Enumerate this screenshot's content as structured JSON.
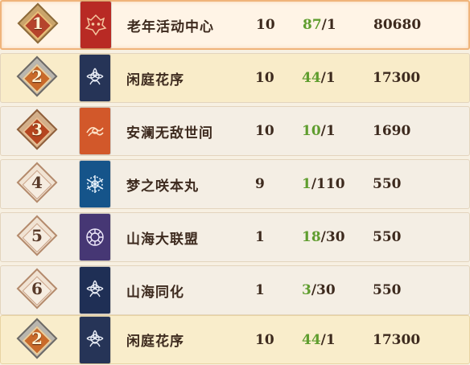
{
  "rows": [
    {
      "rank": "1",
      "name": "老年活动中心",
      "level": "10",
      "members_current": "87",
      "members_max": "/1",
      "score": "80680",
      "badge": "gold",
      "emblem_color": "#b82a24",
      "emblem_icon": "demon-mask-icon"
    },
    {
      "rank": "2",
      "name": "闲庭花序",
      "level": "10",
      "members_current": "44",
      "members_max": "/1",
      "score": "17300",
      "badge": "silver",
      "emblem_color": "#263457",
      "emblem_icon": "flower-crest-icon"
    },
    {
      "rank": "3",
      "name": "安澜无敌世间",
      "level": "10",
      "members_current": "10",
      "members_max": "/1",
      "score": "1690",
      "badge": "bronze",
      "emblem_color": "#d2582a",
      "emblem_icon": "flame-crest-icon"
    },
    {
      "rank": "4",
      "name": "梦之咲本丸",
      "level": "9",
      "members_current": "1",
      "members_max": "/110",
      "score": "550",
      "badge": "plain",
      "emblem_color": "#15548a",
      "emblem_icon": "snowflake-crest-icon"
    },
    {
      "rank": "5",
      "name": "山海大联盟",
      "level": "1",
      "members_current": "18",
      "members_max": "/30",
      "score": "550",
      "badge": "plain",
      "emblem_color": "#463774",
      "emblem_icon": "circle-crest-icon"
    },
    {
      "rank": "6",
      "name": "山海同化",
      "level": "1",
      "members_current": "3",
      "members_max": "/30",
      "score": "550",
      "badge": "plain",
      "emblem_color": "#1f2f55",
      "emblem_icon": "flower-crest-icon"
    }
  ],
  "my_guild": {
    "rank": "2",
    "name": "闲庭花序",
    "level": "10",
    "members_current": "44",
    "members_max": "/1",
    "score": "17300",
    "badge": "silver",
    "emblem_color": "#263457",
    "emblem_icon": "flower-crest-icon"
  }
}
